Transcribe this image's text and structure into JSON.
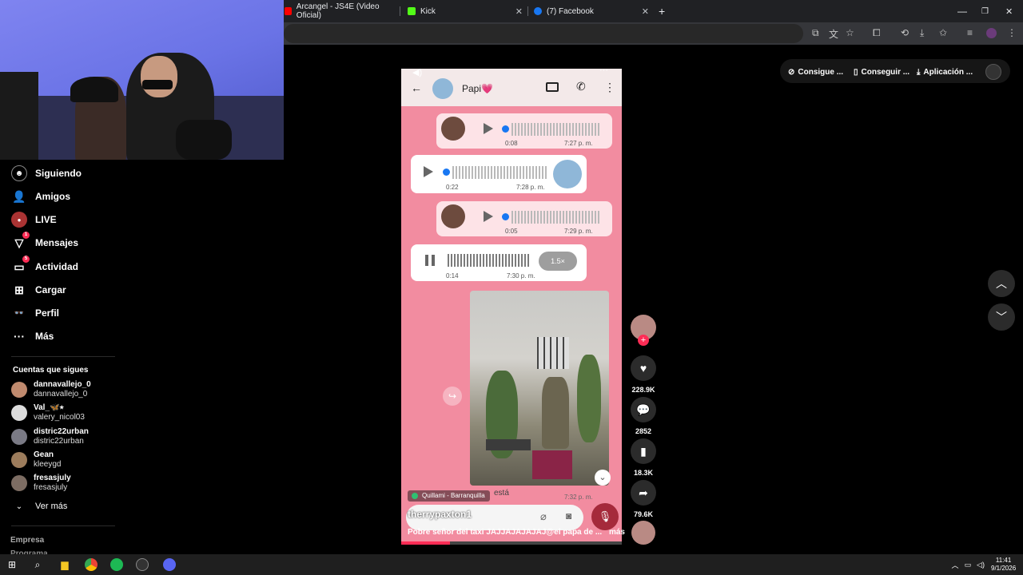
{
  "browser": {
    "tabs": [
      {
        "title": "Arcangel - JS4E (Video Oficial)",
        "favicon_color": "#ff0000"
      },
      {
        "title": "Kick",
        "favicon_color": "#53fc18"
      },
      {
        "title": "(7) Facebook",
        "favicon_color": "#1877f2"
      }
    ],
    "new_tab": "+",
    "close_glyph": "✕"
  },
  "sidebar": {
    "items": [
      {
        "label": "Siguiendo",
        "icon": "following-icon"
      },
      {
        "label": "Amigos",
        "icon": "friends-icon"
      },
      {
        "label": "LIVE",
        "icon": "live-icon"
      },
      {
        "label": "Mensajes",
        "icon": "messages-icon",
        "badge": "1"
      },
      {
        "label": "Actividad",
        "icon": "activity-icon",
        "badge": "5"
      },
      {
        "label": "Cargar",
        "icon": "upload-icon"
      },
      {
        "label": "Perfil",
        "icon": "profile-icon"
      },
      {
        "label": "Más",
        "icon": "more-icon"
      }
    ],
    "following_title": "Cuentas que sigues",
    "following": [
      {
        "name": "dannavallejo_0",
        "handle": "dannavallejo_0"
      },
      {
        "name": "Val_🦋⭑",
        "handle": "valery_nicol03"
      },
      {
        "name": "distric22urban",
        "handle": "distric22urban"
      },
      {
        "name": "Gean",
        "handle": "kleeygd"
      },
      {
        "name": "fresasjuly",
        "handle": "fresasjuly"
      }
    ],
    "see_more": "Ver más",
    "footer_1": "Empresa",
    "footer_2": "Programa"
  },
  "top_pills": [
    {
      "label": "Consigue ...",
      "icon": "coin-icon"
    },
    {
      "label": "Conseguir ...",
      "icon": "phone-icon"
    },
    {
      "label": "Aplicación ...",
      "icon": "download-icon"
    }
  ],
  "video": {
    "chat_name": "Papi💗",
    "messages": [
      {
        "duration": "0:08",
        "time": "7:27 p. m."
      },
      {
        "duration": "0:22",
        "time": "7:28 p. m."
      },
      {
        "duration": "0:05",
        "time": "7:29 p. m."
      },
      {
        "duration": "0:14",
        "time": "7:30 p. m.",
        "speed": "1.5×"
      }
    ],
    "photo_caption": "está",
    "photo_time": "7:32 p. m.",
    "location": "Quillami - Barranquilla",
    "username": "therrypaxton1",
    "description": "Pobre señor del taxi JAJJAJAJAJAJ@el papa de ...",
    "more": "más"
  },
  "actions": [
    {
      "icon": "heart-icon",
      "count": "228.9K"
    },
    {
      "icon": "comment-icon",
      "count": "2852"
    },
    {
      "icon": "bookmark-icon",
      "count": "18.3K"
    },
    {
      "icon": "share-icon",
      "count": "79.6K"
    }
  ],
  "taskbar": {
    "time": "11:41",
    "date": "9/1/2026"
  },
  "colors": {
    "accent": "#fe2c55",
    "whatsapp_blue": "#1877f2",
    "video_bg": "#f28ca0"
  }
}
